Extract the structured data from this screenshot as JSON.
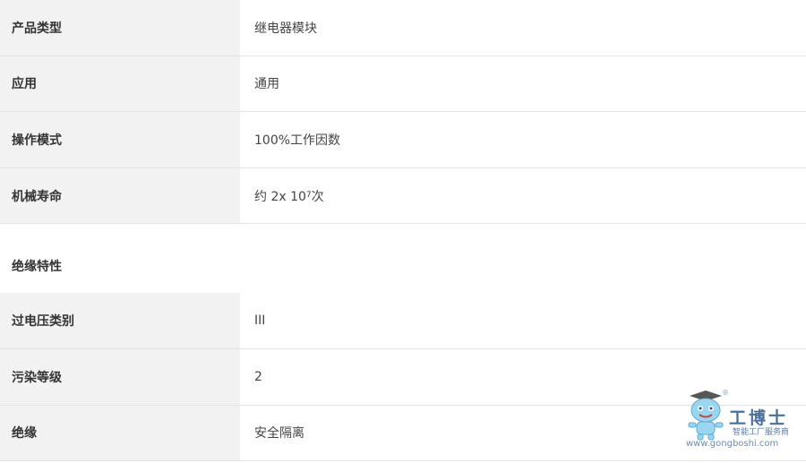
{
  "rows_top": [
    {
      "label": "产品类型",
      "value": "继电器模块"
    },
    {
      "label": "应用",
      "value": "通用"
    },
    {
      "label": "操作模式",
      "value": "100%工作因数"
    }
  ],
  "mech_life": {
    "label": "机械寿命",
    "value_prefix": "约 2x 10",
    "value_sup": "7",
    "value_suffix": "次"
  },
  "section_title": "绝缘特性",
  "rows_bottom": [
    {
      "label": "过电压类别",
      "value": "III"
    },
    {
      "label": "污染等级",
      "value": "2"
    },
    {
      "label": "绝缘",
      "value": "安全隔离"
    }
  ],
  "watermark": {
    "brand": "工博士",
    "subtitle": "智能工厂服务商",
    "url": "www.gongboshi.com",
    "registered": "®",
    "icon": "robot-mascot-icon"
  }
}
